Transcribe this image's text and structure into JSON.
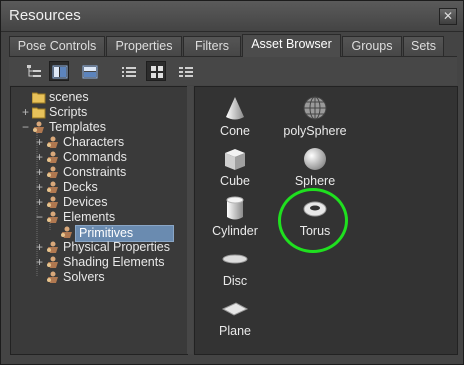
{
  "window": {
    "title": "Resources",
    "close_glyph": "✕"
  },
  "tabs": [
    {
      "label": "Pose Controls",
      "active": false
    },
    {
      "label": "Properties",
      "active": false
    },
    {
      "label": "Filters",
      "active": false
    },
    {
      "label": "Asset Browser",
      "active": true
    },
    {
      "label": "Groups",
      "active": false
    },
    {
      "label": "Sets",
      "active": false
    }
  ],
  "toolbar": {
    "buttons": [
      {
        "icon": "tree-view-icon",
        "pressed": false
      },
      {
        "icon": "split-vertical-icon",
        "pressed": true
      },
      {
        "icon": "split-horizontal-icon",
        "pressed": false
      },
      {
        "icon": "list-view-icon",
        "pressed": false
      },
      {
        "icon": "icon-view-icon",
        "pressed": true
      },
      {
        "icon": "detail-view-icon",
        "pressed": false
      }
    ]
  },
  "tree": {
    "items": [
      {
        "label": "scenes",
        "icon": "folder-icon",
        "expander": ""
      },
      {
        "label": "Scripts",
        "icon": "folder-icon",
        "expander": "+"
      },
      {
        "label": "Templates",
        "icon": "template-icon",
        "expander": "−"
      },
      {
        "label": "Characters",
        "icon": "template-icon",
        "expander": "+"
      },
      {
        "label": "Commands",
        "icon": "template-icon",
        "expander": "+"
      },
      {
        "label": "Constraints",
        "icon": "template-icon",
        "expander": "+"
      },
      {
        "label": "Decks",
        "icon": "template-icon",
        "expander": "+"
      },
      {
        "label": "Devices",
        "icon": "template-icon",
        "expander": "+"
      },
      {
        "label": "Elements",
        "icon": "template-icon",
        "expander": "−"
      },
      {
        "label": "Primitives",
        "icon": "template-icon",
        "expander": "",
        "selected": true
      },
      {
        "label": "Physical Properties",
        "icon": "template-icon",
        "expander": "+"
      },
      {
        "label": "Shading Elements",
        "icon": "template-icon",
        "expander": "+"
      },
      {
        "label": "Solvers",
        "icon": "template-icon",
        "expander": ""
      }
    ]
  },
  "assets": {
    "items": [
      {
        "label": "Cone",
        "icon": "cone-icon"
      },
      {
        "label": "polySphere",
        "icon": "polysphere-icon"
      },
      {
        "label": "Cube",
        "icon": "cube-icon"
      },
      {
        "label": "Sphere",
        "icon": "sphere-icon"
      },
      {
        "label": "Cylinder",
        "icon": "cylinder-icon"
      },
      {
        "label": "Torus",
        "icon": "torus-icon"
      },
      {
        "label": "Disc",
        "icon": "disc-icon"
      },
      {
        "label": "Plane",
        "icon": "plane-icon"
      }
    ]
  },
  "colors": {
    "highlight_circle": "#1fe01f",
    "selection": "#6a8bb0"
  }
}
